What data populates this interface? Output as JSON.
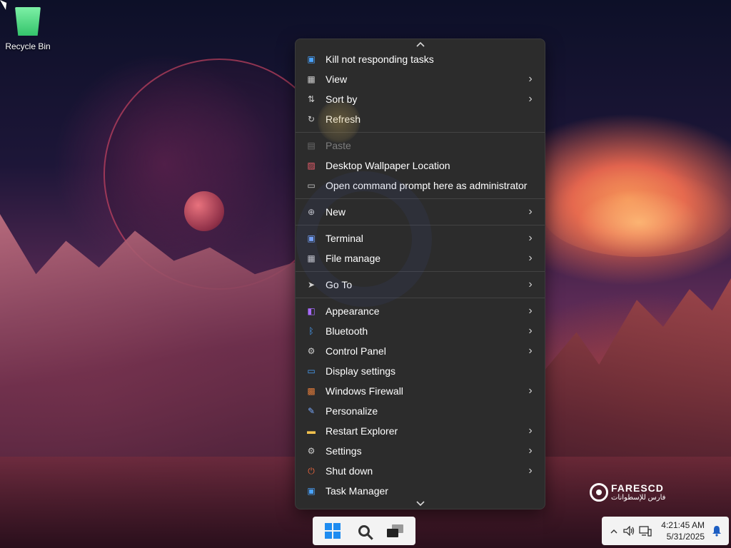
{
  "desktop": {
    "recycle_bin_label": "Recycle Bin"
  },
  "context_menu": {
    "scroll_up_icon": "chevron-up-icon",
    "scroll_down_icon": "chevron-down-icon",
    "items": [
      {
        "label": "Kill not responding tasks",
        "icon": "kill-tasks-icon",
        "submenu": false,
        "disabled": false
      },
      {
        "label": "View",
        "icon": "view-grid-icon",
        "submenu": true,
        "disabled": false
      },
      {
        "label": "Sort by",
        "icon": "sort-icon",
        "submenu": true,
        "disabled": false
      },
      {
        "label": "Refresh",
        "icon": "refresh-icon",
        "submenu": false,
        "disabled": false
      },
      {
        "label": "Paste",
        "icon": "paste-icon",
        "submenu": false,
        "disabled": true
      },
      {
        "label": "Desktop Wallpaper Location",
        "icon": "wallpaper-icon",
        "submenu": false,
        "disabled": false
      },
      {
        "label": "Open command prompt here as administrator",
        "icon": "command-prompt-icon",
        "submenu": false,
        "disabled": false
      },
      {
        "label": "New",
        "icon": "plus-circle-icon",
        "submenu": true,
        "disabled": false
      },
      {
        "label": "Terminal",
        "icon": "terminal-icon",
        "submenu": true,
        "disabled": false
      },
      {
        "label": "File manage",
        "icon": "file-manage-icon",
        "submenu": true,
        "disabled": false
      },
      {
        "label": "Go To",
        "icon": "pointer-icon",
        "submenu": true,
        "disabled": false
      },
      {
        "label": "Appearance",
        "icon": "appearance-icon",
        "submenu": true,
        "disabled": false
      },
      {
        "label": "Bluetooth",
        "icon": "bluetooth-icon",
        "submenu": true,
        "disabled": false
      },
      {
        "label": "Control Panel",
        "icon": "gear-icon",
        "submenu": true,
        "disabled": false
      },
      {
        "label": "Display settings",
        "icon": "display-icon",
        "submenu": false,
        "disabled": false
      },
      {
        "label": "Windows Firewall",
        "icon": "firewall-icon",
        "submenu": true,
        "disabled": false
      },
      {
        "label": "Personalize",
        "icon": "pencil-icon",
        "submenu": false,
        "disabled": false
      },
      {
        "label": "Restart Explorer",
        "icon": "folder-icon",
        "submenu": true,
        "disabled": false
      },
      {
        "label": "Settings",
        "icon": "settings-icon",
        "submenu": true,
        "disabled": false
      },
      {
        "label": "Shut down",
        "icon": "power-icon",
        "submenu": true,
        "disabled": false
      },
      {
        "label": "Task Manager",
        "icon": "task-manager-icon",
        "submenu": false,
        "disabled": false
      }
    ]
  },
  "taskbar": {
    "start_icon": "windows-logo-icon",
    "search_icon": "search-icon",
    "task_view_icon": "task-view-icon"
  },
  "tray": {
    "time": "4:21:45 AM",
    "date": "5/31/2025",
    "chevron_icon": "chevron-up-icon",
    "volume_icon": "volume-icon",
    "network_icon": "network-icon",
    "notification_icon": "bell-icon"
  },
  "brand": {
    "name": "FARESCD",
    "subtitle": "فارس للإسطوانات"
  },
  "colors": {
    "menu_bg": "#2c2c2c",
    "menu_text": "#ffffff",
    "disabled_text": "#7d7d7d",
    "taskbar_bg": "#f3f3f3",
    "windows_blue": "#1f8cf0"
  }
}
